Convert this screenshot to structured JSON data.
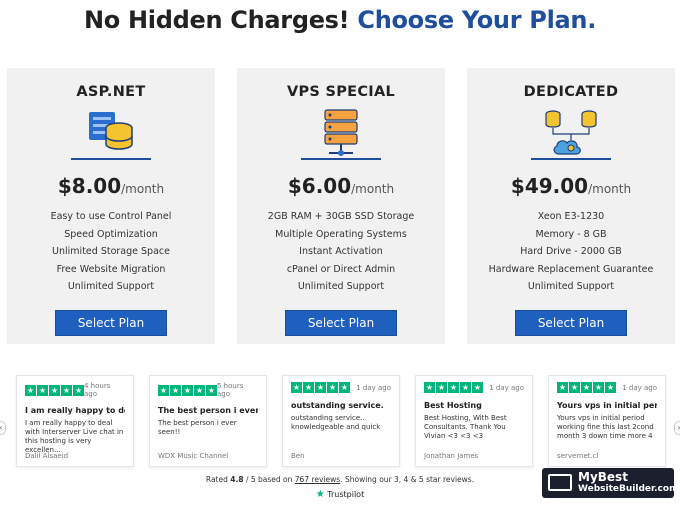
{
  "headline": {
    "part1": "No Hidden Charges!",
    "part2": "Choose Your Plan."
  },
  "plans": [
    {
      "name": "ASP.NET",
      "price": "$8.00",
      "per": "/month",
      "features": [
        "Easy to use Control Panel",
        "Speed Optimization",
        "Unlimited Storage Space",
        "Free Website Migration",
        "Unlimited Support"
      ],
      "button": "Select Plan"
    },
    {
      "name": "VPS SPECIAL",
      "price": "$6.00",
      "per": "/month",
      "features": [
        "2GB RAM + 30GB SSD Storage",
        "Multiple Operating Systems",
        "Instant Activation",
        "cPanel or Direct Admin",
        "Unlimited Support"
      ],
      "button": "Select Plan"
    },
    {
      "name": "DEDICATED",
      "price": "$49.00",
      "per": "/month",
      "features": [
        "Xeon E3-1230",
        "Memory - 8 GB",
        "Hard Drive - 2000 GB",
        "Hardware Replacement Guarantee",
        "Unlimited Support"
      ],
      "button": "Select Plan"
    }
  ],
  "reviews": [
    {
      "time": "4 hours ago",
      "title": "I am really happy to de...",
      "text": "I am really happy to deal with Interserver Live chat in this hosting is very excellen...",
      "author": "Dalil Alsaeid"
    },
    {
      "time": "5 hours ago",
      "title": "The best person i ever ...",
      "text": "The best person i ever seen!!",
      "author": "WDX Music Channel"
    },
    {
      "time": "1 day ago",
      "title": "outstanding service.",
      "text": "outstanding service.. knowledgeable and quick",
      "author": "Ben"
    },
    {
      "time": "1 day ago",
      "title": "Best Hosting",
      "text": "Best Hosting, With Best Consultants. Thank You Vivian <3 <3 <3",
      "author": "Jonathan James"
    },
    {
      "time": "1 day ago",
      "title": "Yours vps in initial peri...",
      "text": "Yours vps in initial period working fine this last 2cond month 3 down time more 4",
      "author": "servernet.cl"
    }
  ],
  "rating": {
    "prefix": "Rated",
    "score": "4.8",
    "mid": "/ 5 based on",
    "reviews_link": "767 reviews",
    "suffix": ". Showing our 3, 4 & 5 star reviews."
  },
  "trustpilot": {
    "star": "★",
    "label": "Trustpilot"
  },
  "brand": {
    "line1": "MyBest",
    "line2": "WebsiteBuilder.com"
  },
  "nav": {
    "prev": "‹",
    "next": "›"
  },
  "colors": {
    "accent": "#1f4f9c",
    "button": "#1f5fbd",
    "trustpilot_green": "#00b67a"
  }
}
